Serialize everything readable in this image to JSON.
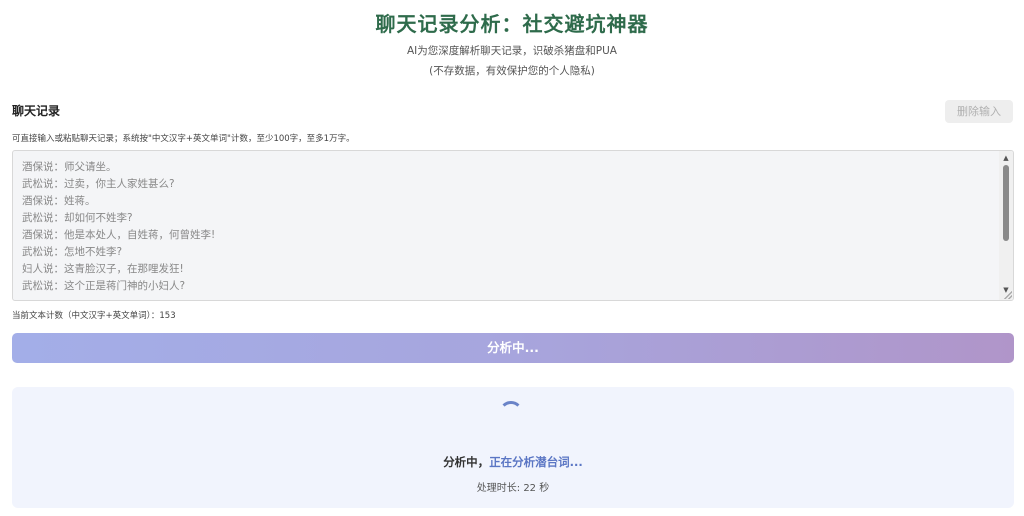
{
  "header": {
    "title": "聊天记录分析：社交避坑神器",
    "subtitle": "AI为您深度解析聊天记录，识破杀猪盘和PUA",
    "privacy_note": "(不存数据，有效保护您的个人隐私)"
  },
  "input_section": {
    "label": "聊天记录",
    "clear_button": "删除输入",
    "hint": "可直接输入或粘贴聊天记录；系统按\"中文汉字+英文单词\"计数，至少100字，至多1万字。",
    "chat_lines": [
      "酒保说：师父请坐。",
      "武松说：过卖，你主人家姓甚么?",
      "酒保说：姓蒋。",
      "武松说：却如何不姓李?",
      "酒保说：他是本处人，自姓蒋，何曾姓李!",
      "武松说：怎地不姓李?",
      "妇人说：这青脸汉子，在那哩发狂!",
      "武松说：这个正是蒋门神的小妇人?"
    ],
    "count_label": "当前文本计数（中文汉字+英文单词）：",
    "count_value": "153"
  },
  "analyze_button": {
    "label": "分析中..."
  },
  "status": {
    "prefix": "分析中，",
    "detail": "正在分析潜台词...",
    "elapsed": "处理时长: 22 秒"
  },
  "colors": {
    "title": "#2e6b4b",
    "accent": "#5b76c4",
    "button_gradient_start": "#a3aee8",
    "button_gradient_end": "#b095c9",
    "panel_bg": "#f1f4fd"
  }
}
